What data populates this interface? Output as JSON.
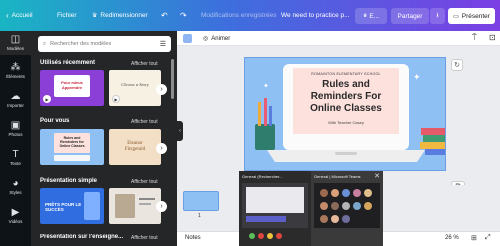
{
  "topbar": {
    "back_label": "Accueil",
    "file_label": "Fichier",
    "resize_label": "Redimensionner",
    "saved_label": "Modifications enregistrées",
    "doc_title": "We need to practice p...",
    "plan_label": "E...",
    "share_label": "Partager",
    "present_label": "Présenter"
  },
  "rail": {
    "items": [
      {
        "label": "Modèles",
        "icon": "templates-icon"
      },
      {
        "label": "Éléments",
        "icon": "elements-icon"
      },
      {
        "label": "Importer",
        "icon": "upload-icon"
      },
      {
        "label": "Photos",
        "icon": "photos-icon"
      },
      {
        "label": "Texte",
        "icon": "text-icon"
      },
      {
        "label": "Styles",
        "icon": "styles-icon"
      },
      {
        "label": "Vidéos",
        "icon": "videos-icon"
      }
    ]
  },
  "panel": {
    "search_placeholder": "Rechercher des modèles",
    "sections": [
      {
        "title": "Utilisés récemment",
        "see_all": "Afficher tout",
        "thumb1_text": "Pour mieux Apprendre",
        "thumb2_text": "Choose a Story"
      },
      {
        "title": "Pour vous",
        "see_all": "Afficher tout",
        "thumb1_text": "Rules and Reminders for Online Classes",
        "thumb2_text": "Eleanor Fitzgerald"
      },
      {
        "title": "Présentation simple",
        "see_all": "Afficher tout",
        "thumb1_text": "PRÊTS POUR LE SUCCÈS",
        "thumb2_text": ""
      },
      {
        "title": "Présentation sur l'enseigne...",
        "see_all": "Afficher tout"
      }
    ]
  },
  "editor": {
    "animate_label": "Animer",
    "slide": {
      "school": "ROMAINTON ELEMENTARY SCHOOL",
      "title_line1": "Rules and",
      "title_line2": "Reminders For",
      "title_line3": "Online Classes",
      "subtitle": "With Teacher Casey"
    }
  },
  "bottom": {
    "page_number": "1",
    "notes_label": "Notes",
    "zoom_label": "26 %"
  },
  "taskbar_preview": {
    "window1_title": "General (Rechercher...",
    "window2_title": "General | Microsoft Teams"
  },
  "colors": {
    "gradient_start": "#19b5c3",
    "gradient_end": "#7b3fe4",
    "panel_bg": "#252627",
    "slide_bg": "#8ec0f4",
    "slide_card": "#fde1dd"
  }
}
